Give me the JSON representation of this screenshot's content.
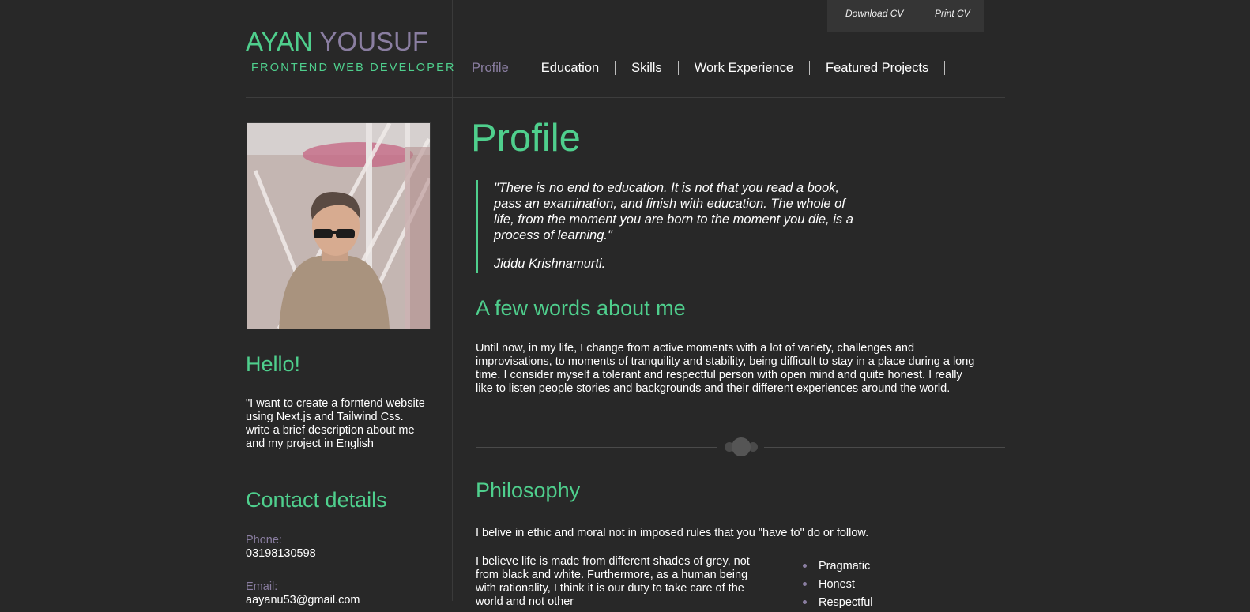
{
  "top_actions": {
    "download_cv": "Download CV",
    "print_cv": "Print CV"
  },
  "brand": {
    "first_name": "AYAN",
    "last_name": "YOUSUF",
    "subtitle": "FRONTEND WEB DEVELOPER"
  },
  "nav": {
    "items": [
      {
        "label": "Profile",
        "active": true
      },
      {
        "label": "Education"
      },
      {
        "label": "Skills"
      },
      {
        "label": "Work Experience"
      },
      {
        "label": "Featured Projects"
      }
    ]
  },
  "sidebar": {
    "hello_heading": "Hello!",
    "hello_text": "\"I want to create a forntend website using Next.js and Tailwind Css. write a brief description about me and my project in English",
    "contact_heading": "Contact details",
    "phone_label": "Phone:",
    "phone_value": "03198130598",
    "email_label": "Email:",
    "email_value": "aayanu53@gmail.com"
  },
  "main": {
    "profile_heading": "Profile",
    "quote_text": "\"There is no end to education. It is not that you read a book, pass an examination, and finish with education. The whole of life, from the moment you are born to the moment you die, is a process of learning.\"",
    "quote_author": "Jiddu Krishnamurti.",
    "about_heading": "A few words about me",
    "about_text": "Until now, in my life, I change from active moments with a lot of variety, challenges and improvisations, to moments of tranquility and stability, being difficult to stay in a place during a long time. I consider myself a tolerant and respectful person with open mind and quite honest. I really like to listen people stories and backgrounds and their different experiences around the world.",
    "philosophy_heading": "Philosophy",
    "philosophy_text1": "I belive in ethic and moral not in imposed rules that you \"have to\" do or follow.",
    "philosophy_text2": "I believe life is made from different shades of grey, not from black and white. Furthermore, as a human being with rationality, I think it is our duty to take care of the world and not other",
    "traits": [
      "Pragmatic",
      "Honest",
      "Respectful"
    ]
  },
  "colors": {
    "accent": "#4fcf8d",
    "muted": "#8a7ea1",
    "background": "#282828"
  }
}
